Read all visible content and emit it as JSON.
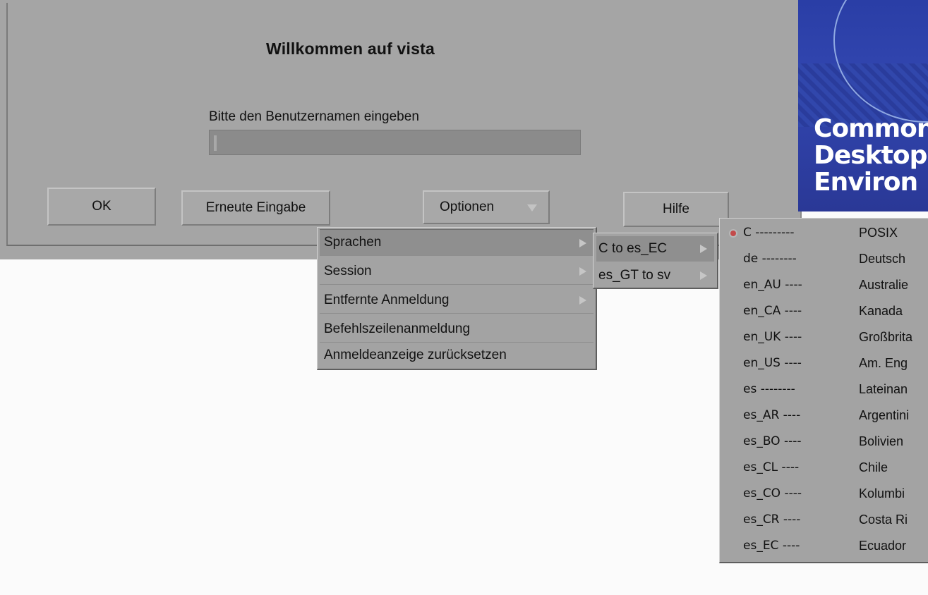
{
  "login": {
    "title": "Willkommen auf vista",
    "prompt": "Bitte den Benutzernamen eingeben",
    "username_value": "",
    "buttons": {
      "ok": "OK",
      "clear": "Erneute Eingabe",
      "options": "Optionen",
      "help": "Hilfe"
    }
  },
  "branding": {
    "lines": [
      "Common",
      "Desktop",
      "Environ"
    ]
  },
  "options_menu": {
    "items": [
      {
        "label": "Sprachen",
        "has_submenu": true,
        "selected": true
      },
      {
        "label": "Session",
        "has_submenu": true
      },
      {
        "label": "Entfernte Anmeldung",
        "has_submenu": true
      },
      {
        "label": "Befehlszeilenanmeldung",
        "has_submenu": false
      },
      {
        "label": "Anmeldeanzeige zurücksetzen",
        "has_submenu": false
      }
    ]
  },
  "language_ranges": {
    "items": [
      {
        "label": "C to es_EC",
        "selected": true
      },
      {
        "label": "es_GT to sv"
      }
    ]
  },
  "locales": {
    "items": [
      {
        "code": "C ---------",
        "lang": "POSIX",
        "selected": true
      },
      {
        "code": "de --------",
        "lang": "Deutsch"
      },
      {
        "code": "en_AU ----",
        "lang": "Australie"
      },
      {
        "code": "en_CA ----",
        "lang": "Kanada"
      },
      {
        "code": "en_UK ----",
        "lang": "Großbrita"
      },
      {
        "code": "en_US ----",
        "lang": "Am. Eng"
      },
      {
        "code": "es --------",
        "lang": "Lateinan"
      },
      {
        "code": "es_AR ----",
        "lang": "Argentini"
      },
      {
        "code": "es_BO ----",
        "lang": "Bolivien"
      },
      {
        "code": "es_CL ----",
        "lang": "Chile"
      },
      {
        "code": "es_CO ----",
        "lang": "Kolumbi"
      },
      {
        "code": "es_CR ----",
        "lang": "Costa Ri"
      },
      {
        "code": "es_EC ----",
        "lang": "Ecuador"
      }
    ]
  },
  "colors": {
    "dialog_bg": "#a5a5a5",
    "menu_bg": "#a3a3a3",
    "highlight": "#8f8f8f",
    "brand_blue": "#2a3ea6"
  }
}
